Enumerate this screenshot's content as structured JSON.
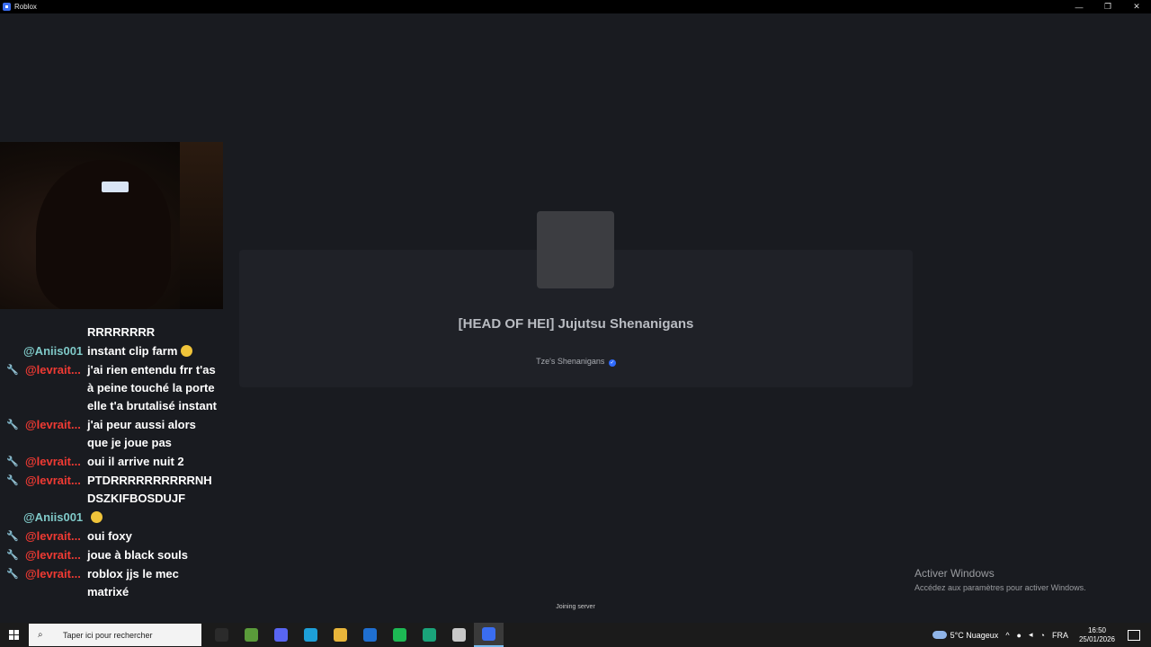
{
  "window": {
    "title": "Roblox",
    "minimize": "—",
    "maximize": "❐",
    "close": "✕"
  },
  "loading": {
    "game_title": "[HEAD OF HEI] Jujutsu Shenanigans",
    "creator": "Tze's Shenanigans",
    "verified_glyph": "✓",
    "status": "Joining server"
  },
  "activation": {
    "title": "Activer Windows",
    "subtitle": "Accédez aux paramètres pour activer Windows."
  },
  "chat": {
    "messages": [
      {
        "user": "",
        "text": "RRRRRRRR",
        "style": "none"
      },
      {
        "user": "@Aniis001",
        "text": "instant clip farm",
        "style": "teal",
        "emoji": "crying-face"
      },
      {
        "user": "@levrait...",
        "text": "j'ai rien entendu frr t'as à peine touché la porte elle t'a brutalisé instant",
        "style": "red"
      },
      {
        "user": "@levrait...",
        "text": "j'ai peur aussi alors que je joue pas",
        "style": "red"
      },
      {
        "user": "@levrait...",
        "text": "oui il arrive nuit 2",
        "style": "red"
      },
      {
        "user": "@levrait...",
        "text": "PTDRRRRRRRRRRNH DSZKIFBOSDUJF",
        "style": "red"
      },
      {
        "user": "@Aniis001",
        "text": "",
        "style": "teal",
        "emoji": "crying-face"
      },
      {
        "user": "@levrait...",
        "text": "oui foxy",
        "style": "red"
      },
      {
        "user": "@levrait...",
        "text": "joue à black souls",
        "style": "red"
      },
      {
        "user": "@levrait...",
        "text": "roblox jjs le mec matrixé",
        "style": "red"
      }
    ]
  },
  "taskbar": {
    "search_placeholder": "Taper ici pour rechercher",
    "apps": [
      {
        "name": "task-view-icon",
        "color": "#2b2b2b"
      },
      {
        "name": "store-icon",
        "color": "#5a9b3a"
      },
      {
        "name": "discord-icon",
        "color": "#5865f2"
      },
      {
        "name": "edge-icon",
        "color": "#1d9fd8"
      },
      {
        "name": "file-explorer-icon",
        "color": "#e8b53a"
      },
      {
        "name": "mail-icon",
        "color": "#1f6fd0"
      },
      {
        "name": "spotify-icon",
        "color": "#1db954"
      },
      {
        "name": "app-icon",
        "color": "#1aa37a"
      },
      {
        "name": "settings-icon",
        "color": "#c8c8c8"
      },
      {
        "name": "roblox-icon",
        "color": "#3a6df0"
      }
    ],
    "weather": "5°C Nuageux",
    "language": "FRA",
    "time": "16:50",
    "date": "25/01/2026"
  }
}
